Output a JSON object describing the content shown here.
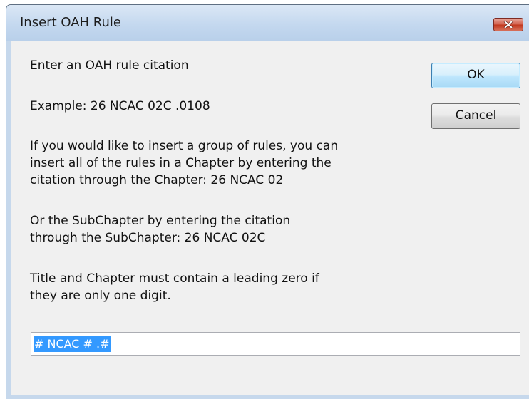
{
  "dialog": {
    "title": "Insert OAH Rule",
    "close_tooltip": "Close"
  },
  "prompt": {
    "line1": "Enter an OAH rule citation",
    "example": "Example:  26 NCAC 02C .0108",
    "group_1": "If you would like to insert a group of rules, you can",
    "group_2": "insert all of the rules in a Chapter by entering the",
    "group_3": "citation through the Chapter:   26 NCAC 02",
    "sub_1": "Or the SubChapter by entering the citation",
    "sub_2": "through the SubChapter:  26 NCAC 02C",
    "note_1": "Title and Chapter must contain a leading zero if",
    "note_2": "they are only one digit."
  },
  "buttons": {
    "ok_label": "OK",
    "cancel_label": "Cancel"
  },
  "input": {
    "value": "# NCAC # .#",
    "selected": true
  },
  "colors": {
    "titlebar": "#c4d8ef",
    "client_bg": "#f0f0f0",
    "selection": "#3399ff",
    "close_button": "#c2391f"
  },
  "icons": {
    "close": "close-x-icon"
  }
}
